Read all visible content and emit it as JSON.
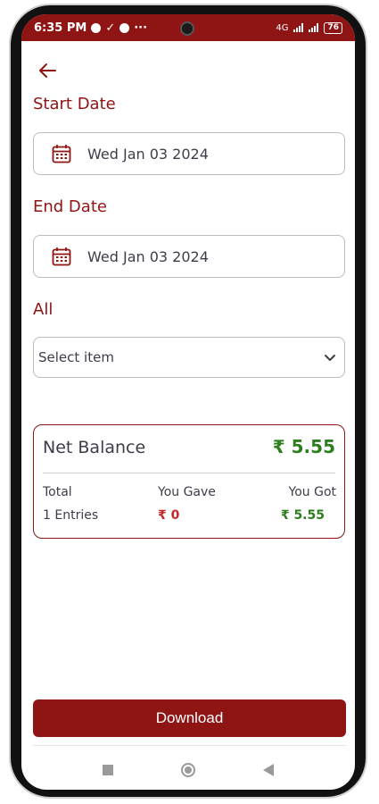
{
  "status_bar": {
    "time": "6:35 PM",
    "extra": "···",
    "network": "4G",
    "battery": "76"
  },
  "filters": {
    "start_label": "Start Date",
    "start_value": "Wed Jan 03 2024",
    "end_label": "End Date",
    "end_value": "Wed Jan 03 2024",
    "category_label": "All",
    "select_placeholder": "Select item"
  },
  "summary": {
    "net_label": "Net Balance",
    "net_value": "₹ 5.55",
    "total_label": "Total",
    "entries": "1 Entries",
    "gave_label": "You Gave",
    "gave_value": "₹ 0",
    "got_label": "You Got",
    "got_value": "₹ 5.55"
  },
  "actions": {
    "download_label": "Download"
  },
  "colors": {
    "brand": "#8f1414",
    "positive": "#2e7d1e",
    "negative": "#c62828"
  },
  "icons": [
    "back-arrow-icon",
    "calendar-icon",
    "chevron-down-icon"
  ]
}
